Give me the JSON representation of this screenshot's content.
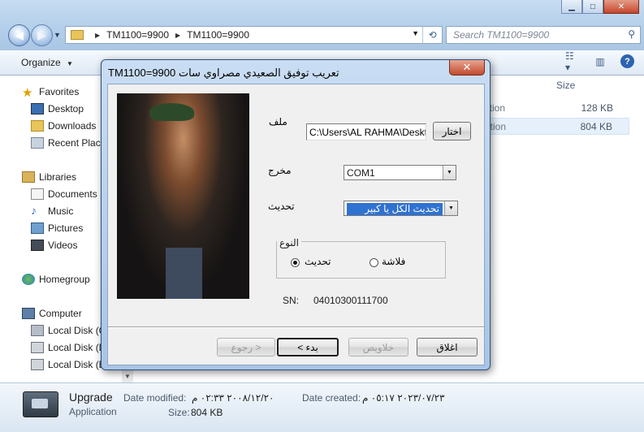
{
  "explorer": {
    "address": {
      "crumb1": "TM1100=9900",
      "crumb2": "TM1100=9900"
    },
    "search_placeholder": "Search TM1100=9900",
    "toolbar": {
      "organize": "Organize"
    },
    "nav": {
      "favorites": "Favorites",
      "desktop": "Desktop",
      "downloads": "Downloads",
      "recent": "Recent Place",
      "libraries": "Libraries",
      "documents": "Documents",
      "music": "Music",
      "pictures": "Pictures",
      "videos": "Videos",
      "homegroup": "Homegroup",
      "computer": "Computer",
      "disk_c": "Local Disk (C",
      "disk_d": "Local Disk (D",
      "disk_e": "Local Disk (E"
    },
    "columns": {
      "size": "Size"
    },
    "files": [
      {
        "type": "ition",
        "size": "128 KB"
      },
      {
        "type": "ition",
        "size": "804 KB"
      }
    ],
    "details": {
      "name": "Upgrade",
      "type": "Application",
      "modified_label": "Date modified:",
      "modified_value": "٢٠٠٨/١٢/٢٠ ٠٢:٣٣ م",
      "created_label": "Date created:",
      "created_value": "٢٠٢٣/٠٧/٢٣ ٠٥:١٧ م",
      "size_label": "Size:",
      "size_value": "804 KB"
    }
  },
  "dialog": {
    "title": "تعريب  توفيق الصعيدي مصراوي سات TM1100=9900",
    "close_glyph": "✕",
    "file_label": "ملف",
    "file_path": "C:\\Users\\AL RAHMA\\Desktop",
    "browse_button": "اختار",
    "output_label": "مخرج",
    "port_value": "COM1",
    "update_label": "تحديث",
    "update_mode": "تحديث الكل يا كبير",
    "type_group": "النوع",
    "radio_update": "تحديث",
    "radio_flash": "فلاشة",
    "sn_label": "SN:",
    "sn_value": "04010300111700",
    "buttons": {
      "back": "رجوع >",
      "start": "< بدء",
      "done": "خلاويص",
      "close": "اغلاق"
    }
  },
  "colors": {
    "selection": "#3072d1",
    "title_gradient": "#b4cfea"
  }
}
